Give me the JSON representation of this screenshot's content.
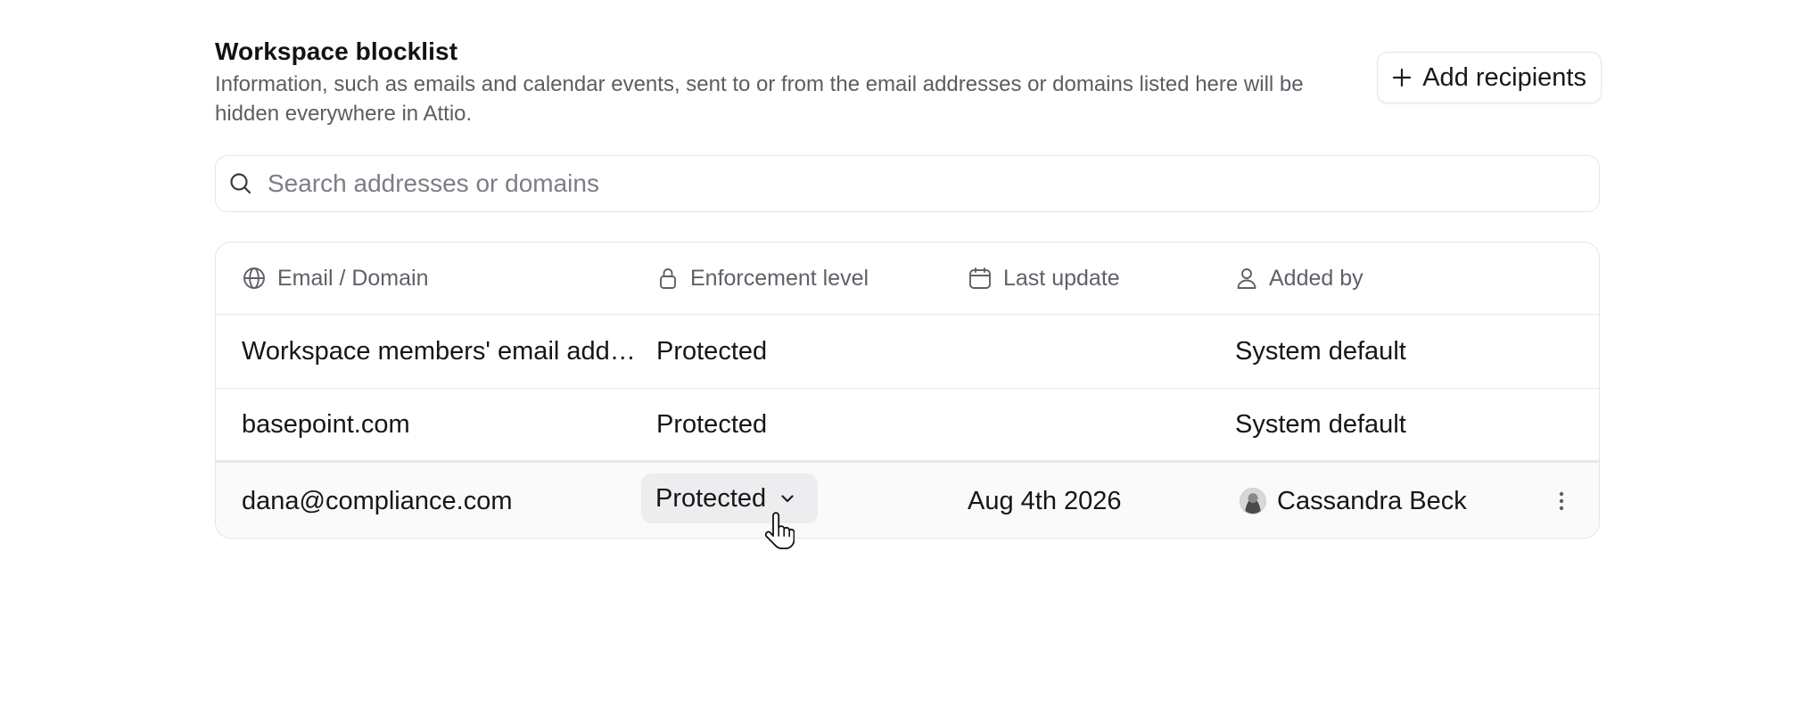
{
  "header": {
    "title": "Workspace blocklist",
    "description": "Information, such as emails and calendar events, sent to or from the email addresses or domains listed here will be hidden everywhere in Attio.",
    "add_button_label": "Add recipients",
    "add_button_icon": "plus-icon"
  },
  "search": {
    "placeholder": "Search addresses or domains",
    "value": "",
    "icon": "search-icon"
  },
  "table": {
    "columns": [
      {
        "label": "Email / Domain",
        "icon": "globe-icon"
      },
      {
        "label": "Enforcement level",
        "icon": "lock-icon"
      },
      {
        "label": "Last update",
        "icon": "calendar-icon"
      },
      {
        "label": "Added by",
        "icon": "user-icon"
      }
    ],
    "rows": [
      {
        "email": "Workspace members' email addresses",
        "enforcement": "Protected",
        "last_update": "",
        "added_by": "System default"
      },
      {
        "email": "basepoint.com",
        "enforcement": "Protected",
        "last_update": "",
        "added_by": "System default"
      },
      {
        "email": "dana@compliance.com",
        "enforcement": "Protected",
        "last_update": "Aug 4th 2026",
        "added_by": "Cassandra Beck"
      }
    ]
  },
  "colors": {
    "border": "#e4e5e8",
    "muted_text": "#5f6168",
    "dropdown_bg": "#ededef",
    "hover_row_bg": "#fafafa"
  }
}
